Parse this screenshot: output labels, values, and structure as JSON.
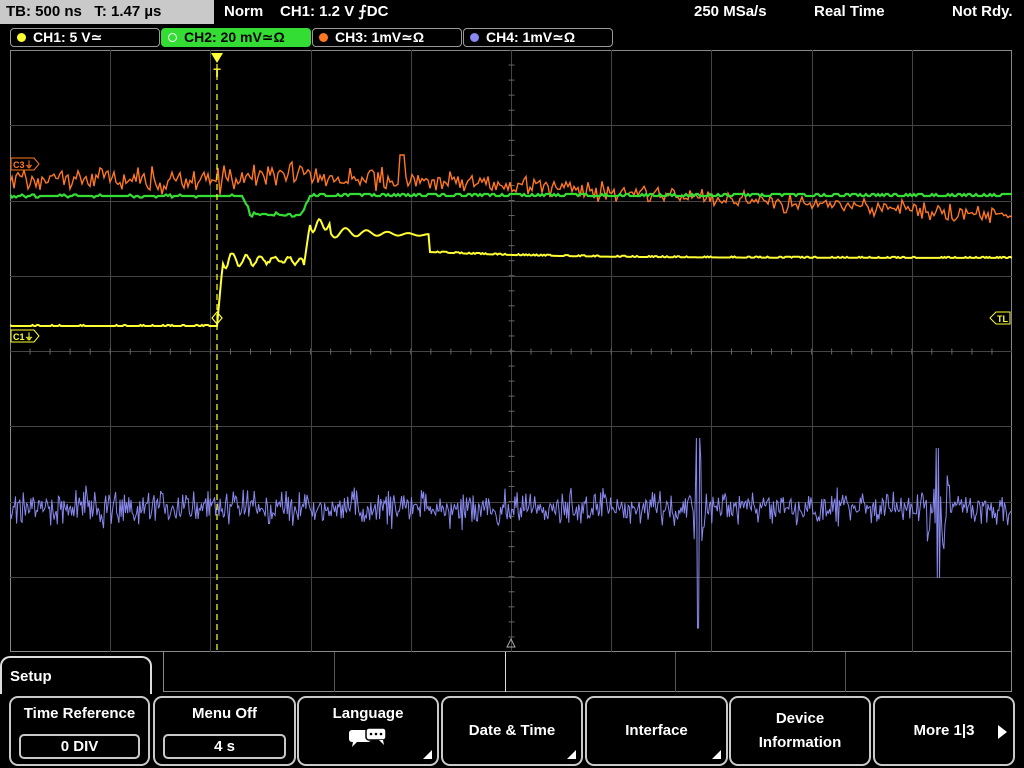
{
  "status_bar": {
    "timebase": "TB: 500 ns",
    "time_position": "T: 1.47 µs",
    "trigger_mode": "Norm",
    "trigger_info": "CH1: 1.2 V ⨍DC",
    "sample_rate": "250 MSa/s",
    "acquisition_mode": "Real Time",
    "trigger_status": "Not Rdy."
  },
  "channels": [
    {
      "label": "CH1: 5 V≃",
      "color": "#ffff33"
    },
    {
      "label": "CH2: 20 mV≃Ω",
      "color": "#33dd33"
    },
    {
      "label": "CH3: 1mV≃Ω",
      "color": "#ff7722"
    },
    {
      "label": "CH4: 1mV≃Ω",
      "color": "#8888ee"
    }
  ],
  "markers": {
    "c3": "C3⏚",
    "c1": "C1⏚",
    "trigger_level": "TL",
    "trigger_position": "T"
  },
  "menu": {
    "title": "Setup",
    "softkeys": [
      {
        "label": "Time Reference",
        "value": "0 DIV"
      },
      {
        "label": "Menu Off",
        "value": "4 s"
      },
      {
        "label": "Language",
        "icon": "speech-bubbles-icon"
      },
      {
        "label": "Date & Time"
      },
      {
        "label": "Interface"
      },
      {
        "label": "Device Information"
      },
      {
        "label": "More 1|3"
      }
    ]
  },
  "colors": {
    "grid": "#4a4a4a",
    "grid_border": "#888888",
    "trigger_line": "#ffff33",
    "active_tab": "#33dd33",
    "status_box": "#c9c9c9"
  }
}
